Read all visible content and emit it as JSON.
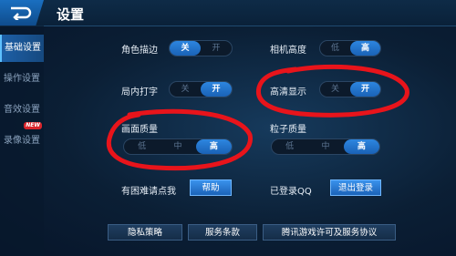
{
  "header": {
    "title": "设置"
  },
  "sidebar": {
    "items": [
      {
        "label": "基础设置",
        "active": true
      },
      {
        "label": "操作设置",
        "active": false
      },
      {
        "label": "音效设置",
        "active": false
      },
      {
        "label": "录像设置",
        "active": false,
        "badge": "NEW"
      }
    ]
  },
  "settings": {
    "outline": {
      "label": "角色描边",
      "options": [
        "关",
        "开"
      ],
      "selected": "关"
    },
    "camera_height": {
      "label": "相机高度",
      "options": [
        "低",
        "高"
      ],
      "selected": "高"
    },
    "local_typing": {
      "label": "局内打字",
      "options": [
        "关",
        "开"
      ],
      "selected": "开"
    },
    "hd_display": {
      "label": "高清显示",
      "options": [
        "关",
        "开"
      ],
      "selected": "开"
    },
    "quality": {
      "label": "画面质量",
      "options": [
        "低",
        "中",
        "高"
      ],
      "selected": "高"
    },
    "particles": {
      "label": "粒子质量",
      "options": [
        "低",
        "中",
        "高"
      ],
      "selected": "高"
    }
  },
  "help": {
    "label": "有困难请点我",
    "button": "帮助"
  },
  "account": {
    "label": "已登录QQ",
    "button": "退出登录"
  },
  "footer": {
    "privacy": "隐私策略",
    "terms": "服务条款",
    "license": "腾讯游戏许可及服务协议"
  },
  "colors": {
    "accent": "#2d86e0",
    "annotation": "#e8141b"
  }
}
